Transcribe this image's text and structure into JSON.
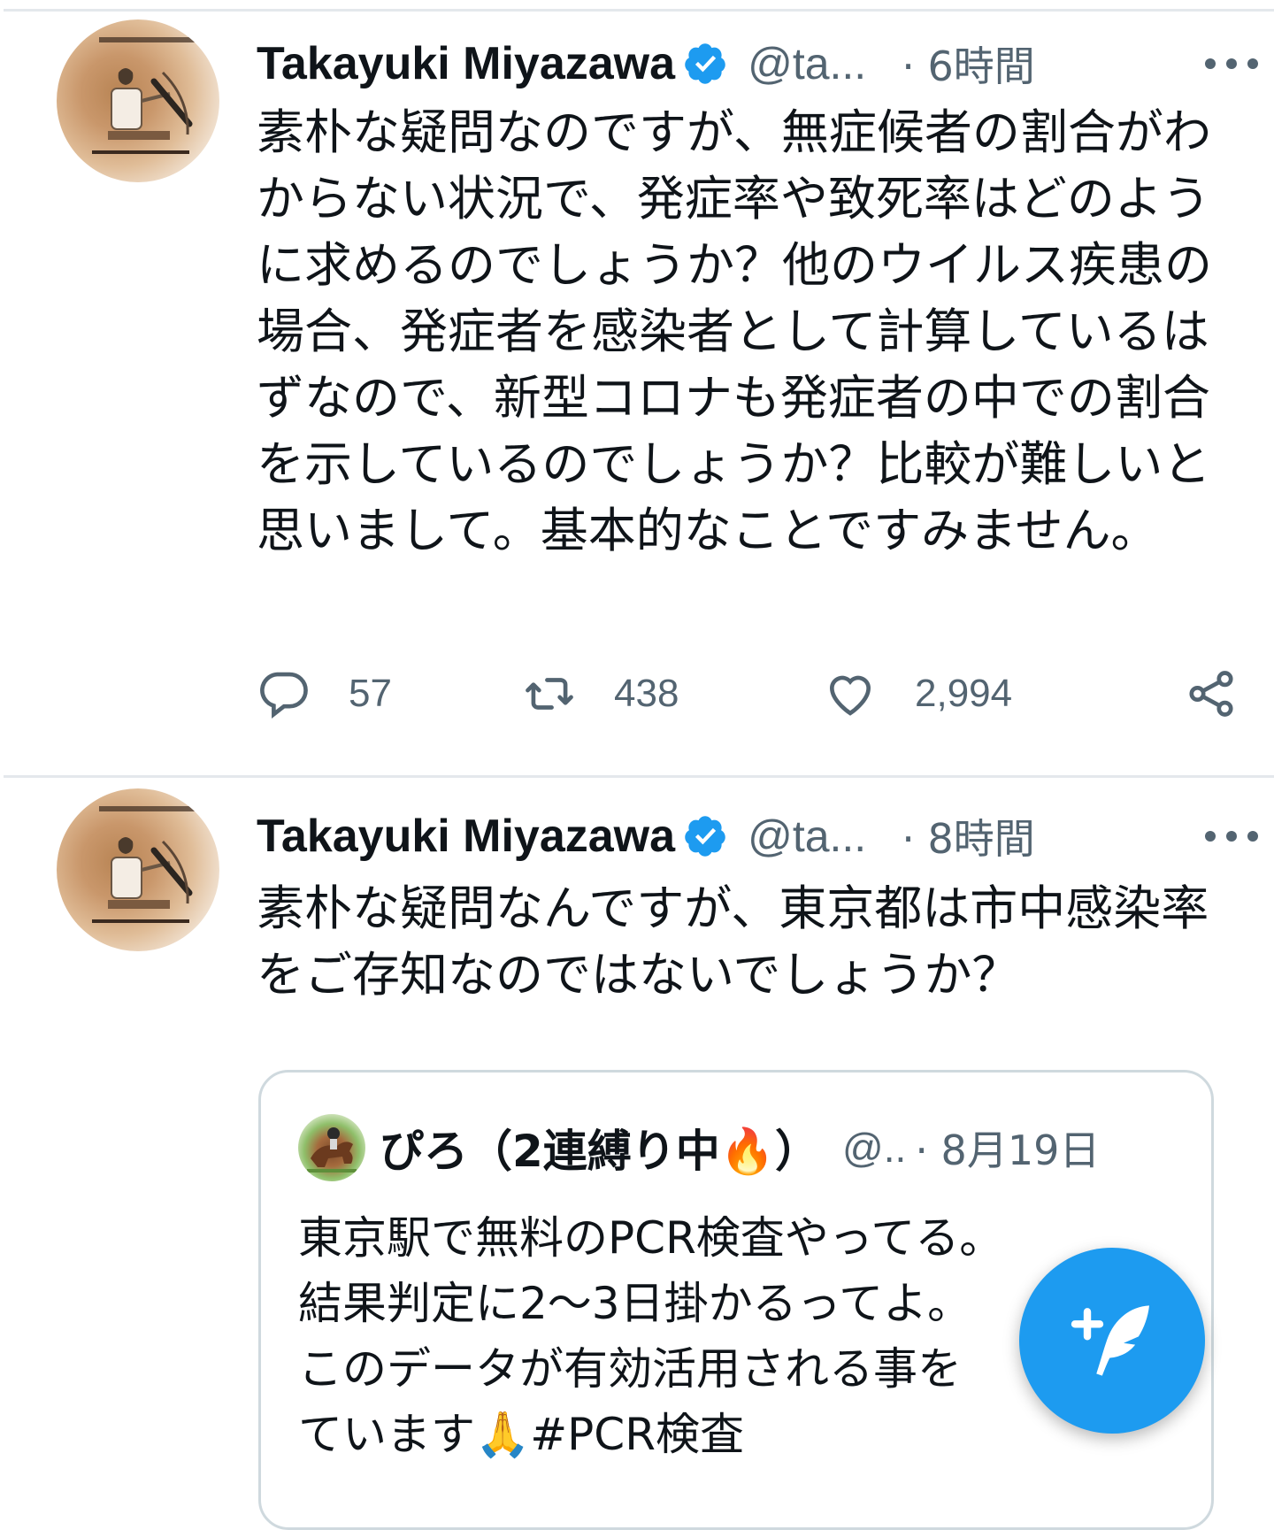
{
  "tweets": [
    {
      "name": "Takayuki Miyazawa",
      "handle": "@ta...",
      "time": "· 6時間",
      "text": "素朴な疑問なのですが、無症候者の割合がわからない状況で、発症率や致死率はどのように求めるのでしょうか？他のウイルス疾患の場合、発症者を感染者として計算しているはずなので、新型コロナも発症者の中での割合を示しているのでしょうか？比較が難しいと思いまして。基本的なことですみません。",
      "replies": "57",
      "retweets": "438",
      "likes": "2,994"
    },
    {
      "name": "Takayuki Miyazawa",
      "handle": "@ta...",
      "time": "· 8時間",
      "text": "素朴な疑問なんですが、東京都は市中感染率をご存知なのではないでしょうか？",
      "quote": {
        "name": "ぴろ（2連縛り中🔥）",
        "handle": "@..",
        "time": "· 8月19日",
        "lines": [
          "東京駅で無料のPCR検査やってる。",
          "結果判定に2〜3日掛かるってよ。",
          "このデータが有効活用される事を",
          "ています🙏#PCR検査"
        ]
      }
    }
  ],
  "colors": {
    "accent": "#1d9bf0",
    "verified": "#1d9bf0",
    "secondary_text": "#536471",
    "divider": "#e4e8ec"
  },
  "icons": {
    "reply": "reply-icon",
    "retweet": "retweet-icon",
    "like": "heart-icon",
    "share": "share-icon",
    "more": "more-icon",
    "verified": "verified-badge-icon",
    "compose": "compose-tweet-icon"
  }
}
